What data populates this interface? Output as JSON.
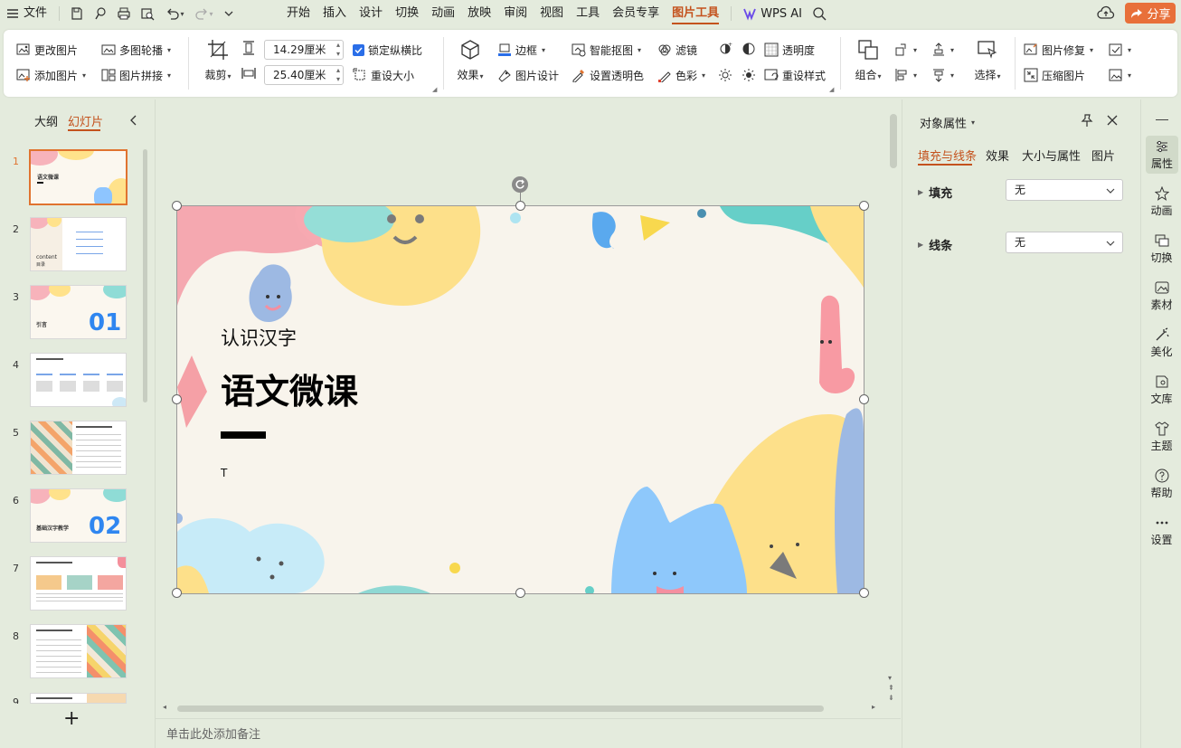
{
  "menubar": {
    "file_label": "文件",
    "tabs": [
      "开始",
      "插入",
      "设计",
      "切换",
      "动画",
      "放映",
      "审阅",
      "视图",
      "工具",
      "会员专享",
      "图片工具"
    ],
    "wps_ai": "WPS AI",
    "share": "分享"
  },
  "ribbon": {
    "change_picture": "更改图片",
    "multi_carousel": "多图轮播",
    "add_picture": "添加图片",
    "picture_collage": "图片拼接",
    "crop": "裁剪",
    "height_value": "14.29厘米",
    "width_value": "25.40厘米",
    "lock_aspect": "锁定纵横比",
    "reset_size": "重设大小",
    "effects": "效果",
    "border": "边框",
    "picture_design": "图片设计",
    "smart_cutout": "智能抠图",
    "set_transparent_color": "设置透明色",
    "filter": "滤镜",
    "color": "色彩",
    "transparency": "透明度",
    "reset_style": "重设样式",
    "group": "组合",
    "select": "选择",
    "picture_repair": "图片修复",
    "compress_picture": "压缩图片"
  },
  "leftpanel": {
    "outline_tab": "大纲",
    "slides_tab": "幻灯片",
    "slide_numbers": [
      "1",
      "2",
      "3",
      "4",
      "5",
      "6",
      "7",
      "8",
      "9"
    ],
    "thumb_texts": {
      "t1_title": "语文微课",
      "t2_content": "content",
      "t2_sub": "目录",
      "t3_title": "引言",
      "t3_num": "01",
      "t6_title": "基础汉字教学",
      "t6_num": "02"
    },
    "add_slide": "+"
  },
  "slide": {
    "subtitle": "认识汉字",
    "title": "语文微课",
    "text_cursor": "T"
  },
  "notes": {
    "placeholder": "单击此处添加备注"
  },
  "rpane": {
    "title": "对象属性",
    "tabs": [
      "填充与线条",
      "效果",
      "大小与属性",
      "图片"
    ],
    "fill_label": "填充",
    "fill_value": "无",
    "line_label": "线条",
    "line_value": "无"
  },
  "dock": {
    "items": [
      "属性",
      "动画",
      "切换",
      "素材",
      "美化",
      "文库",
      "主题",
      "帮助",
      "设置"
    ]
  },
  "colors": {
    "accent": "#c4521d",
    "share_bg": "#e8703a",
    "checkbox": "#2a6ee8",
    "app_bg": "#e4ebdd"
  }
}
